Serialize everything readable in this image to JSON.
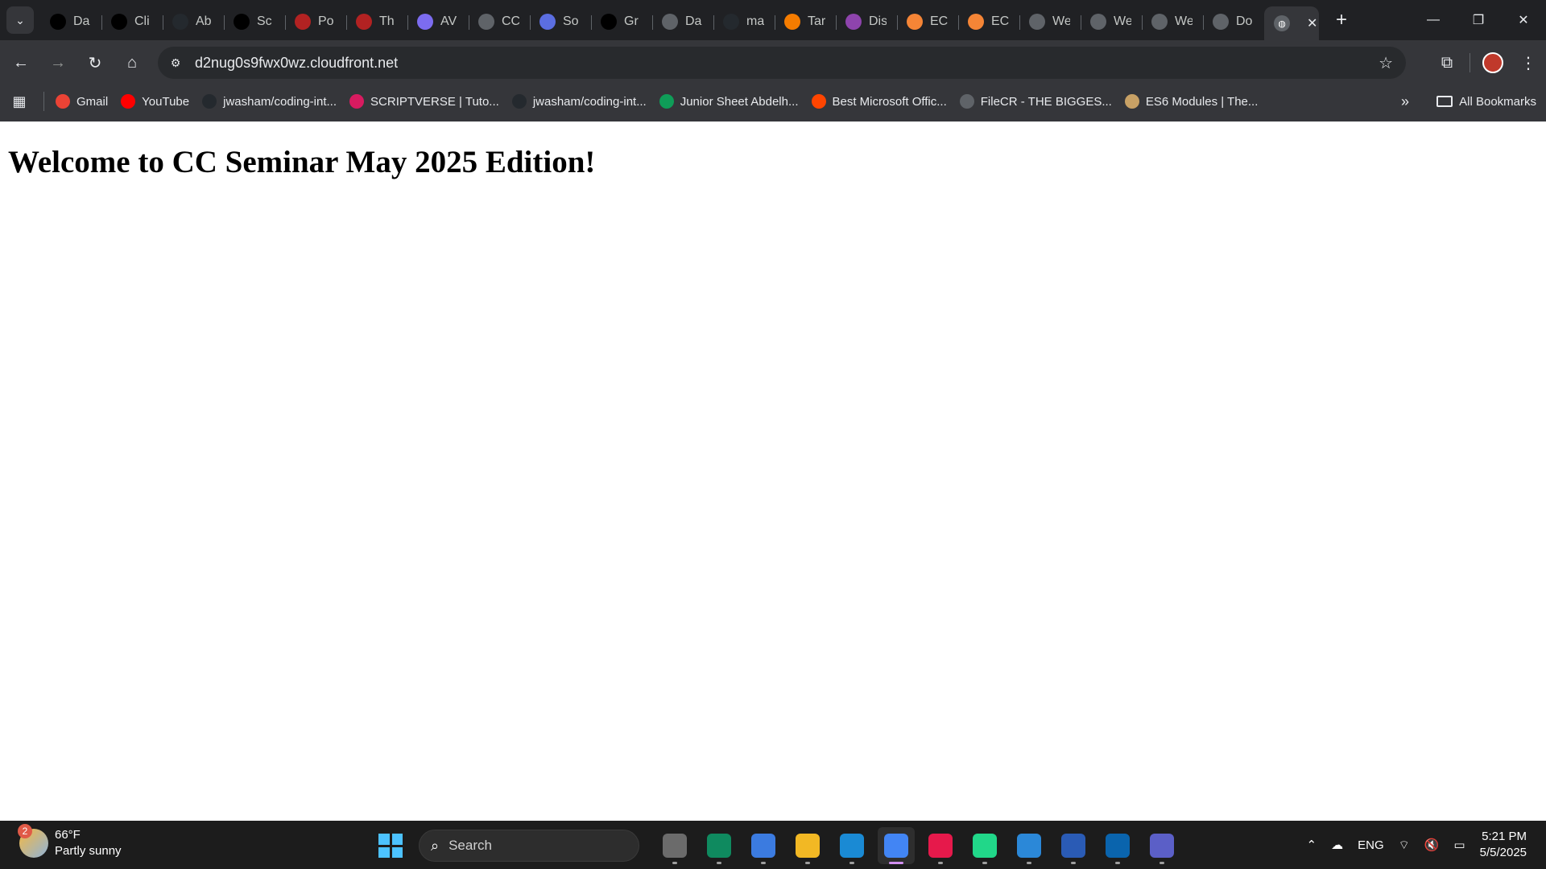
{
  "tabs": [
    {
      "title": "Da",
      "icon": "hackerrank-icon",
      "color": "#000000"
    },
    {
      "title": "Cli",
      "icon": "hackerrank-icon",
      "color": "#000000"
    },
    {
      "title": "Ab",
      "icon": "github-icon",
      "color": "#24292e"
    },
    {
      "title": "Sc",
      "icon": "openai-icon",
      "color": "#000000"
    },
    {
      "title": "Po",
      "icon": "figure-icon",
      "color": "#b22222"
    },
    {
      "title": "Th",
      "icon": "figure-icon",
      "color": "#b22222"
    },
    {
      "title": "AV",
      "icon": "cube-icon",
      "color": "#7c6cf0"
    },
    {
      "title": "CC",
      "icon": "globe-icon",
      "color": "#5f6368"
    },
    {
      "title": "So",
      "icon": "code-icon",
      "color": "#5b6ee1"
    },
    {
      "title": "Gr",
      "icon": "arrow-icon",
      "color": "#000000"
    },
    {
      "title": "Da",
      "icon": "globe-icon",
      "color": "#5f6368"
    },
    {
      "title": "ma",
      "icon": "github-icon",
      "color": "#24292e"
    },
    {
      "title": "Tar",
      "icon": "tar-icon",
      "color": "#f57c00"
    },
    {
      "title": "Dis",
      "icon": "discord-icon",
      "color": "#8e44ad"
    },
    {
      "title": "EC",
      "icon": "aws-ec2-icon",
      "color": "#f58536"
    },
    {
      "title": "EC",
      "icon": "aws-ec2-icon",
      "color": "#f58536"
    },
    {
      "title": "We",
      "icon": "globe-icon",
      "color": "#5f6368"
    },
    {
      "title": "We",
      "icon": "globe-icon",
      "color": "#5f6368"
    },
    {
      "title": "We",
      "icon": "globe-icon",
      "color": "#5f6368"
    },
    {
      "title": "Do",
      "icon": "globe-icon",
      "color": "#5f6368"
    }
  ],
  "active_tab": {
    "icon": "globe-icon",
    "close": "✕"
  },
  "toolbar": {
    "url": "d2nug0s9fwx0wz.cloudfront.net"
  },
  "bookmarks": [
    {
      "label": "Gmail",
      "icon": "gmail-icon",
      "color": "#ea4335"
    },
    {
      "label": "YouTube",
      "icon": "youtube-icon",
      "color": "#ff0000"
    },
    {
      "label": "jwasham/coding-int...",
      "icon": "github-icon",
      "color": "#24292e"
    },
    {
      "label": "SCRIPTVERSE | Tuto...",
      "icon": "scriptverse-icon",
      "color": "#d81b60"
    },
    {
      "label": "jwasham/coding-int...",
      "icon": "github-icon",
      "color": "#24292e"
    },
    {
      "label": "Junior Sheet Abdelh...",
      "icon": "sheets-icon",
      "color": "#0f9d58"
    },
    {
      "label": "Best Microsoft Offic...",
      "icon": "reddit-icon",
      "color": "#ff4500"
    },
    {
      "label": "FileCR - THE BIGGES...",
      "icon": "globe-icon",
      "color": "#5f6368"
    },
    {
      "label": "ES6 Modules | The...",
      "icon": "deer-icon",
      "color": "#c8a165"
    }
  ],
  "all_bookmarks_label": "All Bookmarks",
  "page": {
    "heading": "Welcome to CC Seminar May 2025 Edition!"
  },
  "taskbar": {
    "weather_temp": "66°F",
    "weather_desc": "Partly sunny",
    "weather_badge": "2",
    "search_placeholder": "Search",
    "apps": [
      {
        "icon": "task-view-icon",
        "color": "#6b6b6b"
      },
      {
        "icon": "edge-icon",
        "color": "#0f8a5f"
      },
      {
        "icon": "store-icon",
        "color": "#3b7be0"
      },
      {
        "icon": "file-explorer-icon",
        "color": "#f2b824"
      },
      {
        "icon": "vscode-icon",
        "color": "#1a8ad4"
      },
      {
        "icon": "chrome-icon",
        "color": "#4285f4",
        "active": true
      },
      {
        "icon": "intellij-icon",
        "color": "#e6194b"
      },
      {
        "icon": "clion-icon",
        "color": "#21d789"
      },
      {
        "icon": "notepad-icon",
        "color": "#2b88d8"
      },
      {
        "icon": "powershell-icon",
        "color": "#2a5bb5"
      },
      {
        "icon": "outlook-icon",
        "color": "#0a64ad"
      },
      {
        "icon": "teams-icon",
        "color": "#5b5fc7"
      }
    ],
    "lang": "ENG",
    "time": "5:21 PM",
    "date": "5/5/2025"
  }
}
